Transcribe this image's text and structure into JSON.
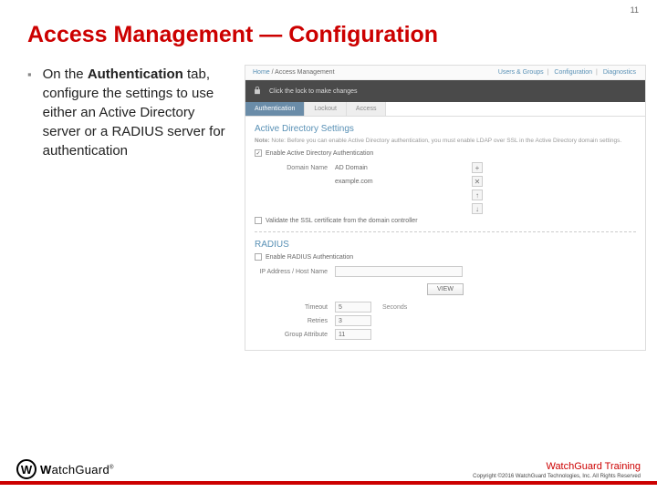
{
  "page_number": "11",
  "title": "Access Management — Configuration",
  "bullet": {
    "pre": "On the ",
    "bold": "Authentication",
    "post": " tab, configure the settings to use either an Active Directory server or a RADIUS server for authentication"
  },
  "ui": {
    "breadcrumb": {
      "home": "Home",
      "sep": "/",
      "current": "Access Management"
    },
    "toplinks": {
      "a": "Users & Groups",
      "b": "Configuration",
      "c": "Diagnostics"
    },
    "lock_msg": "Click the lock to make changes",
    "tabs": {
      "auth": "Authentication",
      "lockout": "Lockout",
      "access": "Access"
    },
    "ad": {
      "title": "Active Directory Settings",
      "note": "Note: Before you can enable Active Directory authentication, you must enable LDAP over SSL in the Active Directory domain settings.",
      "enable": "Enable Active Directory Authentication",
      "domain_label": "Domain Name",
      "domain_header": "AD Domain",
      "domain_value": "example.com",
      "validate": "Validate the SSL certificate from the domain controller"
    },
    "radius": {
      "title": "RADIUS",
      "enable": "Enable RADIUS Authentication",
      "host_label": "IP Address / Host Name",
      "view": "VIEW",
      "timeout_label": "Timeout",
      "timeout_val": "5",
      "timeout_unit": "Seconds",
      "retries_label": "Retries",
      "retries_val": "3",
      "group_label": "Group Attribute",
      "group_val": "11"
    }
  },
  "footer": {
    "brand_w": "W",
    "brand_rest": "atchGuard",
    "training": "WatchGuard Training",
    "copyright": "Copyright ©2016 WatchGuard Technologies, Inc. All Rights Reserved"
  }
}
